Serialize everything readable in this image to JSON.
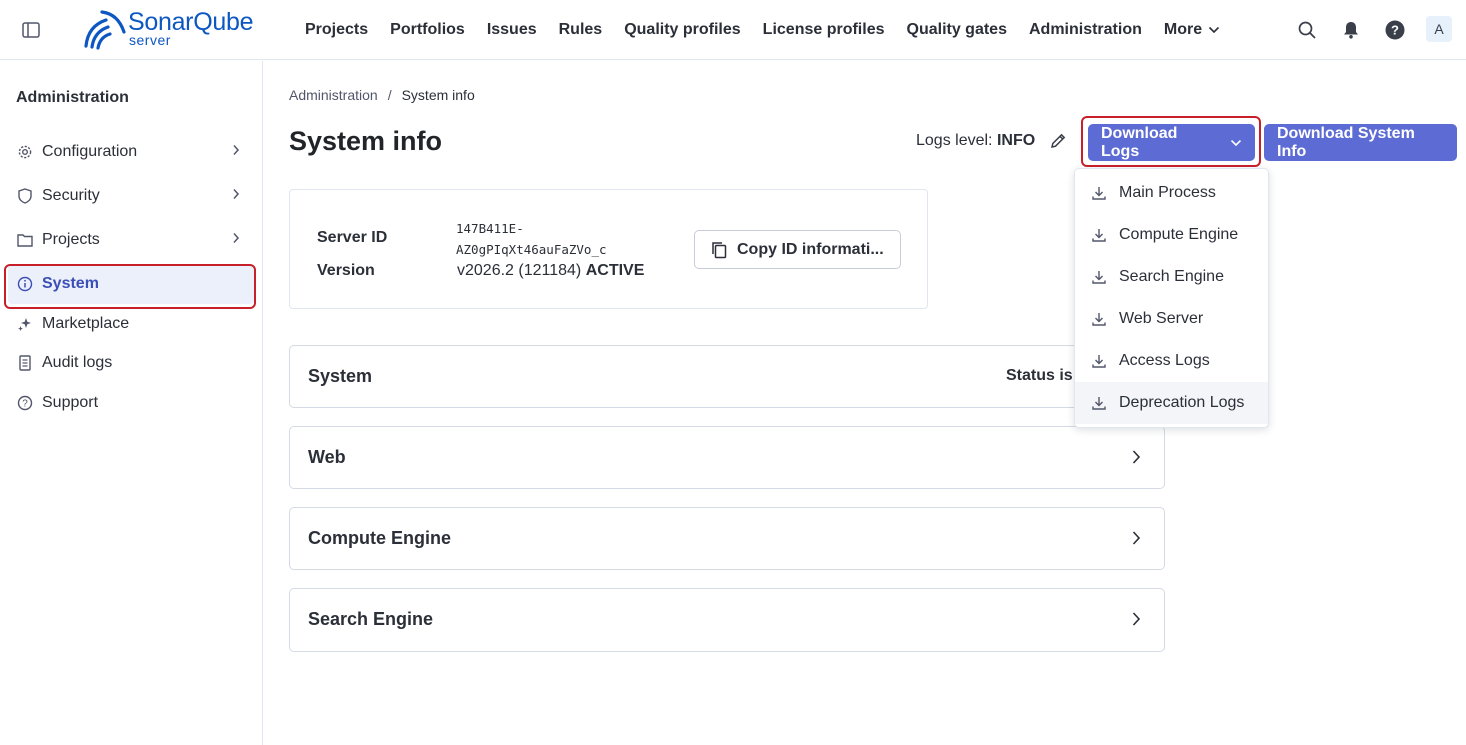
{
  "app": {
    "logo_main": "SonarQube",
    "logo_sub": "server"
  },
  "nav": {
    "items": [
      "Projects",
      "Portfolios",
      "Issues",
      "Rules",
      "Quality profiles",
      "License profiles",
      "Quality gates",
      "Administration"
    ],
    "more_label": "More"
  },
  "user": {
    "avatar_letter": "A"
  },
  "sidebar": {
    "title": "Administration",
    "items": [
      {
        "label": "Configuration",
        "icon": "gear-icon",
        "has_chevron": true
      },
      {
        "label": "Security",
        "icon": "shield-icon",
        "has_chevron": true
      },
      {
        "label": "Projects",
        "icon": "folder-icon",
        "has_chevron": true
      },
      {
        "label": "System",
        "icon": "info-icon",
        "active": true
      },
      {
        "label": "Marketplace",
        "icon": "sparkle-icon"
      },
      {
        "label": "Audit logs",
        "icon": "document-icon"
      },
      {
        "label": "Support",
        "icon": "help-icon"
      }
    ]
  },
  "breadcrumb": {
    "root": "Administration",
    "separator": "/",
    "current": "System info"
  },
  "page": {
    "title": "System info",
    "logs_level_label": "Logs level:",
    "logs_level_value": "INFO",
    "download_logs_label": "Download Logs",
    "download_system_info_label": "Download System Info"
  },
  "server": {
    "server_id_label": "Server ID",
    "server_id_line1": "147B411E-",
    "server_id_line2": "AZ0gPIqXt46auFaZVo_c",
    "version_label": "Version",
    "version_value": "v2026.2 (121184)",
    "version_status": "ACTIVE",
    "copy_label": "Copy ID informati..."
  },
  "sections": [
    {
      "title": "System",
      "status": "Status is"
    },
    {
      "title": "Web"
    },
    {
      "title": "Compute Engine"
    },
    {
      "title": "Search Engine"
    }
  ],
  "dropdown": {
    "items": [
      "Main Process",
      "Compute Engine",
      "Search Engine",
      "Web Server",
      "Access Logs",
      "Deprecation Logs"
    ],
    "hovered_index": 5
  },
  "colors": {
    "primary": "#5d6cd4",
    "highlight": "#c8202a",
    "brand": "#0d57c2"
  }
}
